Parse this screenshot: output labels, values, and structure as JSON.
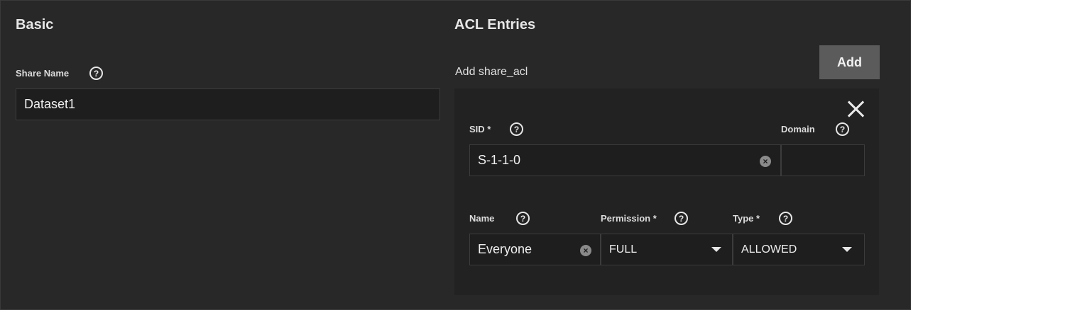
{
  "basic": {
    "title": "Basic",
    "share_name_label": "Share Name",
    "share_name_value": "Dataset1"
  },
  "acl": {
    "title": "ACL Entries",
    "add_label": "Add share_acl",
    "add_button": "Add",
    "entry": {
      "sid_label": "SID *",
      "sid_value": "S-1-1-0",
      "domain_label": "Domain",
      "domain_value": "",
      "name_label": "Name",
      "name_value": "Everyone",
      "permission_label": "Permission *",
      "permission_value": "FULL",
      "type_label": "Type *",
      "type_value": "ALLOWED"
    }
  },
  "icons": {
    "help": "?",
    "clear": "×"
  },
  "colors": {
    "panel_bg": "#282828",
    "card_bg": "#222222",
    "input_bg": "#1e1e1e",
    "button_bg": "#5b5b5b",
    "text": "#e8e8e8"
  }
}
